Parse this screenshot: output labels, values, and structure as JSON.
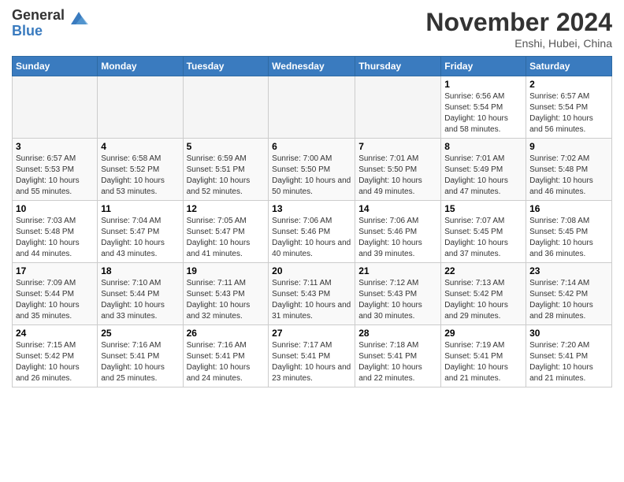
{
  "header": {
    "logo_general": "General",
    "logo_blue": "Blue",
    "month_title": "November 2024",
    "location": "Enshi, Hubei, China"
  },
  "weekdays": [
    "Sunday",
    "Monday",
    "Tuesday",
    "Wednesday",
    "Thursday",
    "Friday",
    "Saturday"
  ],
  "weeks": [
    [
      {
        "day": "",
        "empty": true
      },
      {
        "day": "",
        "empty": true
      },
      {
        "day": "",
        "empty": true
      },
      {
        "day": "",
        "empty": true
      },
      {
        "day": "",
        "empty": true
      },
      {
        "day": "1",
        "sunrise": "6:56 AM",
        "sunset": "5:54 PM",
        "daylight": "10 hours and 58 minutes."
      },
      {
        "day": "2",
        "sunrise": "6:57 AM",
        "sunset": "5:54 PM",
        "daylight": "10 hours and 56 minutes."
      }
    ],
    [
      {
        "day": "3",
        "sunrise": "6:57 AM",
        "sunset": "5:53 PM",
        "daylight": "10 hours and 55 minutes."
      },
      {
        "day": "4",
        "sunrise": "6:58 AM",
        "sunset": "5:52 PM",
        "daylight": "10 hours and 53 minutes."
      },
      {
        "day": "5",
        "sunrise": "6:59 AM",
        "sunset": "5:51 PM",
        "daylight": "10 hours and 52 minutes."
      },
      {
        "day": "6",
        "sunrise": "7:00 AM",
        "sunset": "5:50 PM",
        "daylight": "10 hours and 50 minutes."
      },
      {
        "day": "7",
        "sunrise": "7:01 AM",
        "sunset": "5:50 PM",
        "daylight": "10 hours and 49 minutes."
      },
      {
        "day": "8",
        "sunrise": "7:01 AM",
        "sunset": "5:49 PM",
        "daylight": "10 hours and 47 minutes."
      },
      {
        "day": "9",
        "sunrise": "7:02 AM",
        "sunset": "5:48 PM",
        "daylight": "10 hours and 46 minutes."
      }
    ],
    [
      {
        "day": "10",
        "sunrise": "7:03 AM",
        "sunset": "5:48 PM",
        "daylight": "10 hours and 44 minutes."
      },
      {
        "day": "11",
        "sunrise": "7:04 AM",
        "sunset": "5:47 PM",
        "daylight": "10 hours and 43 minutes."
      },
      {
        "day": "12",
        "sunrise": "7:05 AM",
        "sunset": "5:47 PM",
        "daylight": "10 hours and 41 minutes."
      },
      {
        "day": "13",
        "sunrise": "7:06 AM",
        "sunset": "5:46 PM",
        "daylight": "10 hours and 40 minutes."
      },
      {
        "day": "14",
        "sunrise": "7:06 AM",
        "sunset": "5:46 PM",
        "daylight": "10 hours and 39 minutes."
      },
      {
        "day": "15",
        "sunrise": "7:07 AM",
        "sunset": "5:45 PM",
        "daylight": "10 hours and 37 minutes."
      },
      {
        "day": "16",
        "sunrise": "7:08 AM",
        "sunset": "5:45 PM",
        "daylight": "10 hours and 36 minutes."
      }
    ],
    [
      {
        "day": "17",
        "sunrise": "7:09 AM",
        "sunset": "5:44 PM",
        "daylight": "10 hours and 35 minutes."
      },
      {
        "day": "18",
        "sunrise": "7:10 AM",
        "sunset": "5:44 PM",
        "daylight": "10 hours and 33 minutes."
      },
      {
        "day": "19",
        "sunrise": "7:11 AM",
        "sunset": "5:43 PM",
        "daylight": "10 hours and 32 minutes."
      },
      {
        "day": "20",
        "sunrise": "7:11 AM",
        "sunset": "5:43 PM",
        "daylight": "10 hours and 31 minutes."
      },
      {
        "day": "21",
        "sunrise": "7:12 AM",
        "sunset": "5:43 PM",
        "daylight": "10 hours and 30 minutes."
      },
      {
        "day": "22",
        "sunrise": "7:13 AM",
        "sunset": "5:42 PM",
        "daylight": "10 hours and 29 minutes."
      },
      {
        "day": "23",
        "sunrise": "7:14 AM",
        "sunset": "5:42 PM",
        "daylight": "10 hours and 28 minutes."
      }
    ],
    [
      {
        "day": "24",
        "sunrise": "7:15 AM",
        "sunset": "5:42 PM",
        "daylight": "10 hours and 26 minutes."
      },
      {
        "day": "25",
        "sunrise": "7:16 AM",
        "sunset": "5:41 PM",
        "daylight": "10 hours and 25 minutes."
      },
      {
        "day": "26",
        "sunrise": "7:16 AM",
        "sunset": "5:41 PM",
        "daylight": "10 hours and 24 minutes."
      },
      {
        "day": "27",
        "sunrise": "7:17 AM",
        "sunset": "5:41 PM",
        "daylight": "10 hours and 23 minutes."
      },
      {
        "day": "28",
        "sunrise": "7:18 AM",
        "sunset": "5:41 PM",
        "daylight": "10 hours and 22 minutes."
      },
      {
        "day": "29",
        "sunrise": "7:19 AM",
        "sunset": "5:41 PM",
        "daylight": "10 hours and 21 minutes."
      },
      {
        "day": "30",
        "sunrise": "7:20 AM",
        "sunset": "5:41 PM",
        "daylight": "10 hours and 21 minutes."
      }
    ]
  ]
}
